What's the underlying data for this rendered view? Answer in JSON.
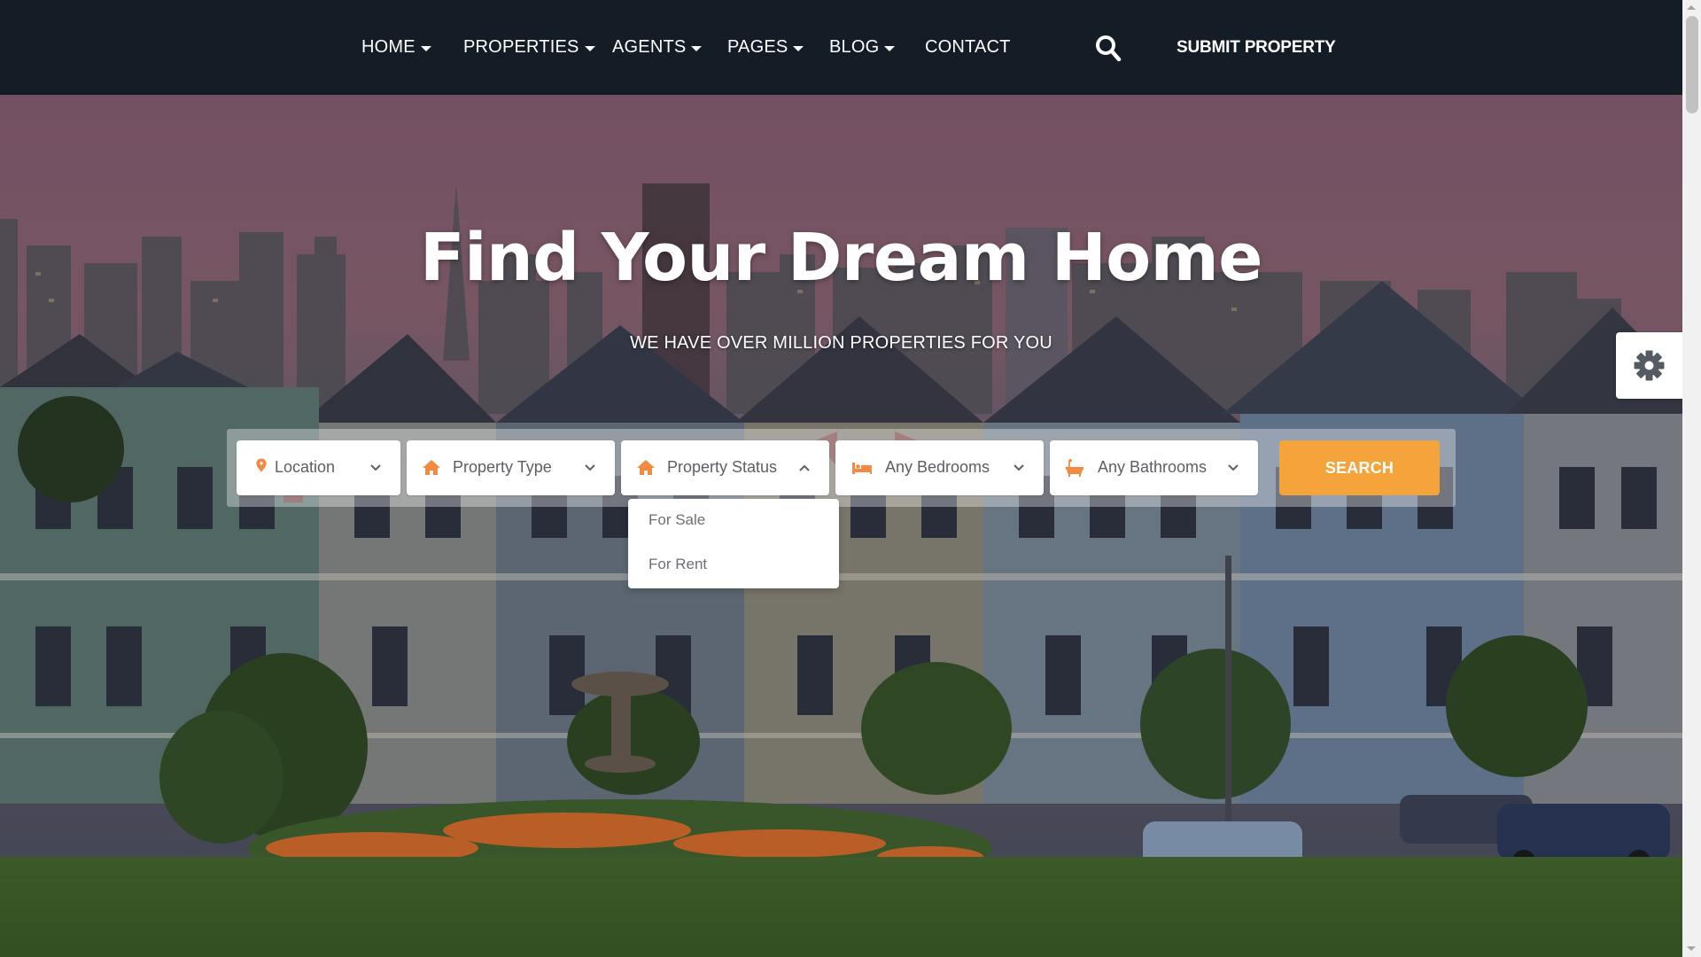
{
  "nav": {
    "items": [
      {
        "label": "HOME",
        "has_dropdown": true
      },
      {
        "label": "PROPERTIES",
        "has_dropdown": true
      },
      {
        "label": "AGENTS",
        "has_dropdown": true
      },
      {
        "label": "PAGES",
        "has_dropdown": true
      },
      {
        "label": "BLOG",
        "has_dropdown": true
      },
      {
        "label": "CONTACT",
        "has_dropdown": false
      }
    ],
    "search_icon": "search-icon",
    "submit_label": "SUBMIT PROPERTY"
  },
  "hero": {
    "title": "Find Your Dream Home",
    "subtitle": "WE HAVE OVER MILLION PROPERTIES FOR YOU"
  },
  "search": {
    "location": {
      "label": "Location",
      "icon": "map-marker-icon"
    },
    "property_type": {
      "label": "Property Type",
      "icon": "home-icon"
    },
    "property_status": {
      "label": "Property Status",
      "icon": "home-icon",
      "expanded": true
    },
    "bedrooms": {
      "label": "Any Bedrooms",
      "icon": "bed-icon"
    },
    "bathrooms": {
      "label": "Any Bathrooms",
      "icon": "bath-icon"
    },
    "button_label": "SEARCH",
    "status_options": [
      "For Sale",
      "For Rent"
    ]
  },
  "settings": {
    "icon": "gear-icon"
  },
  "colors": {
    "navbar": "#141d26",
    "accent": "#f5a43c",
    "accent_icon": "#f28a43",
    "text_muted": "#5b5f66"
  }
}
